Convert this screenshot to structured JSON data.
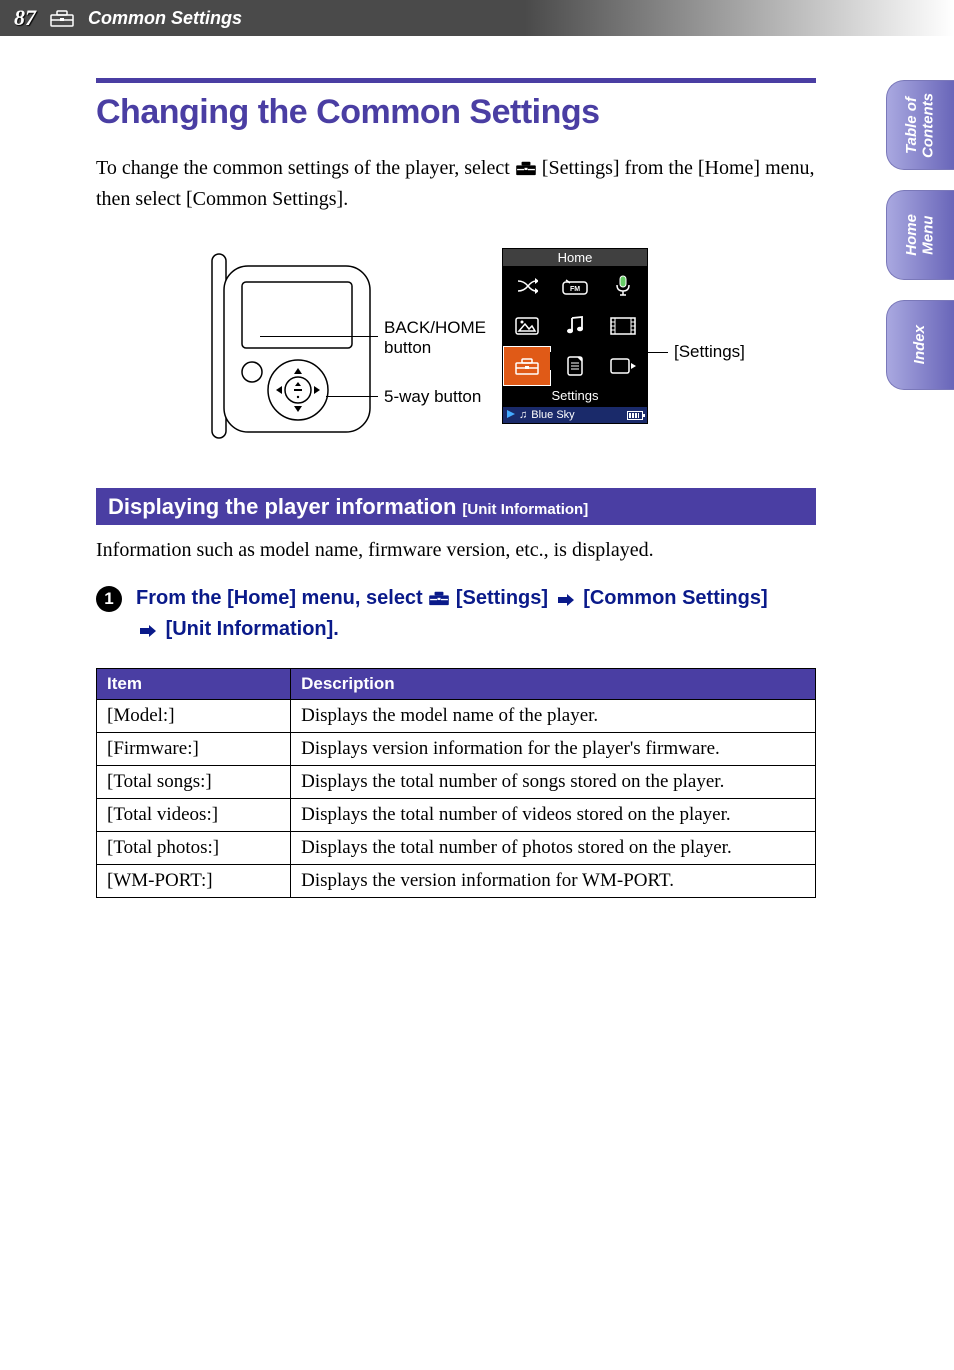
{
  "header": {
    "page_number": "87",
    "section_title": "Common Settings"
  },
  "side_tabs": {
    "toc": "Table of\nContents",
    "home": "Home\nMenu",
    "index": "Index"
  },
  "title": "Changing the Common Settings",
  "intro": {
    "part1": "To change the common settings of the player, select ",
    "part2": " [Settings] from the [Home] menu, then select [Common Settings]."
  },
  "diagram": {
    "back_home": "BACK/HOME button",
    "five_way": "5-way button",
    "settings_callout": "[Settings]",
    "screen_title": "Home",
    "screen_selected_label": "Settings",
    "now_playing": "Blue Sky"
  },
  "section": {
    "main": "Displaying the player information",
    "sub": "[Unit Information]",
    "desc": "Information such as model name, firmware version, etc., is displayed."
  },
  "step": {
    "number": "1",
    "prefix": "From the [Home] menu, select ",
    "seg1": "[Settings]",
    "seg2": "[Common Settings]",
    "seg3": "[Unit Information]."
  },
  "table": {
    "headers": {
      "item": "Item",
      "desc": "Description"
    },
    "rows": [
      {
        "item": "[Model:]",
        "desc": "Displays the model name of the player."
      },
      {
        "item": "[Firmware:]",
        "desc": "Displays version information for the player's firmware."
      },
      {
        "item": "[Total songs:]",
        "desc": "Displays the total number of songs stored on the player."
      },
      {
        "item": "[Total videos:]",
        "desc": "Displays the total number of videos stored on the player."
      },
      {
        "item": "[Total photos:]",
        "desc": "Displays the total number of photos stored on the player."
      },
      {
        "item": "[WM-PORT:]",
        "desc": "Displays the version information for WM-PORT."
      }
    ]
  }
}
